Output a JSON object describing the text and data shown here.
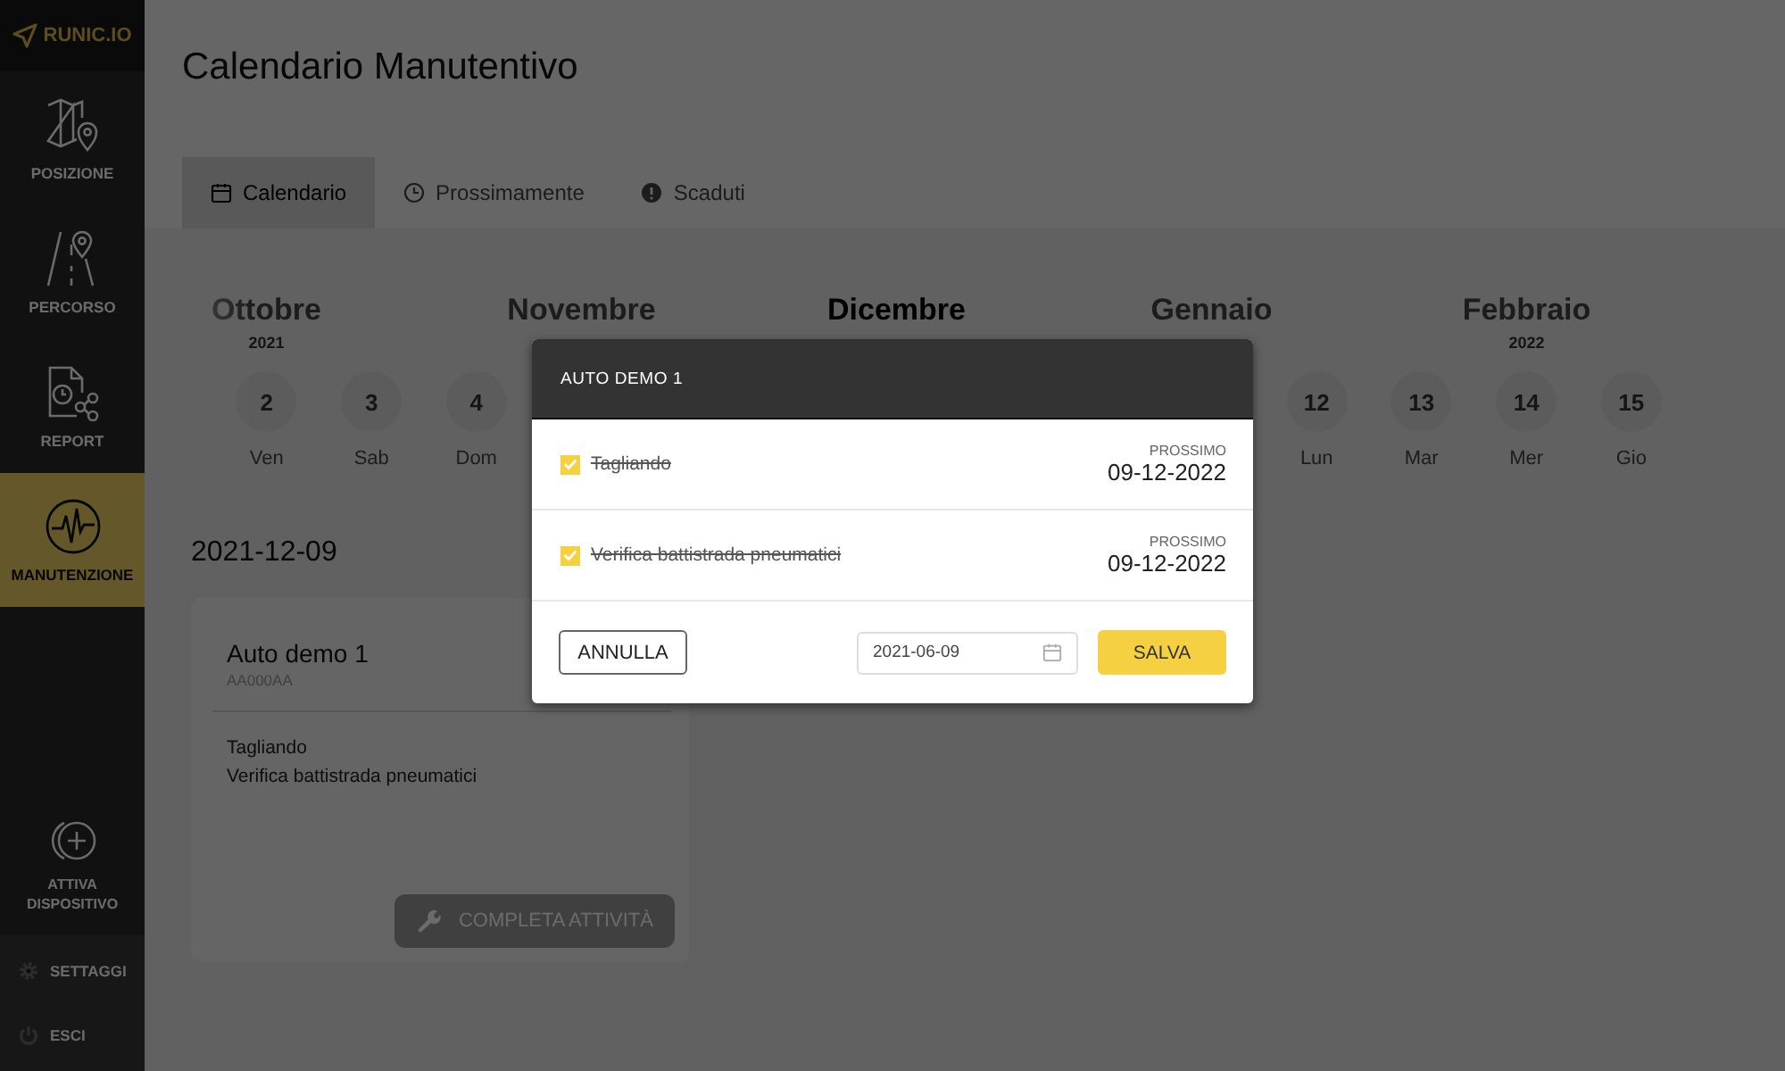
{
  "sidebar": {
    "logo": "RUNIC.IO",
    "items": [
      {
        "label": "POSIZIONE",
        "kind": "map",
        "selected": false
      },
      {
        "label": "PERCORSO",
        "kind": "road",
        "selected": false
      },
      {
        "label": "REPORT",
        "kind": "report",
        "selected": false
      },
      {
        "label": "MANUTENZIONE",
        "kind": "pulse",
        "selected": true
      }
    ],
    "activate": "ATTIVA DISPOSITIVO",
    "footer": [
      {
        "label": "SETTAGGI",
        "kind": "gear"
      },
      {
        "label": "ESCI",
        "kind": "power"
      }
    ]
  },
  "page": {
    "title": "Calendario Manutentivo",
    "tabs": [
      {
        "label": "Calendario",
        "kind": "calendar",
        "selected": true
      },
      {
        "label": "Prossimamente",
        "kind": "clock",
        "selected": false
      },
      {
        "label": "Scaduti",
        "kind": "alert",
        "selected": false
      }
    ],
    "months": [
      {
        "name": "Ottobre",
        "year": "2021",
        "selected": false
      },
      {
        "name": "Novembre",
        "selected": false
      },
      {
        "name": "Dicembre",
        "selected": true
      },
      {
        "name": "Gennaio",
        "selected": false
      },
      {
        "name": "Febbraio",
        "year": "2022",
        "selected": false
      }
    ],
    "day_groups": [
      [
        {
          "day": "2",
          "weekday": "Ven"
        },
        {
          "day": "3",
          "weekday": "Sab"
        },
        {
          "day": "4",
          "weekday": "Dom"
        }
      ],
      [
        {
          "day": "12",
          "weekday": "Lun"
        },
        {
          "day": "13",
          "weekday": "Mar"
        },
        {
          "day": "14",
          "weekday": "Mer"
        },
        {
          "day": "15",
          "weekday": "Gio"
        }
      ]
    ],
    "date": "2021-12-09",
    "card": {
      "title": "Auto demo 1",
      "plate": "AA000AA",
      "tasks": [
        "Tagliando",
        "Verifica battistrada pneumatici"
      ],
      "button": "COMPLETA ATTIVITÀ",
      "disabled": true
    }
  },
  "modal": {
    "title": "AUTO DEMO 1",
    "rows": [
      {
        "label": "Tagliando",
        "checked": true,
        "caption": "PROSSIMO",
        "date": "09-12-2022"
      },
      {
        "label": "Verifica battistrada pneumatici",
        "checked": true,
        "caption": "PROSSIMO",
        "date": "09-12-2022"
      }
    ],
    "cancel": "ANNULLA",
    "date_value": "2021-06-09",
    "save": "SALVA"
  }
}
